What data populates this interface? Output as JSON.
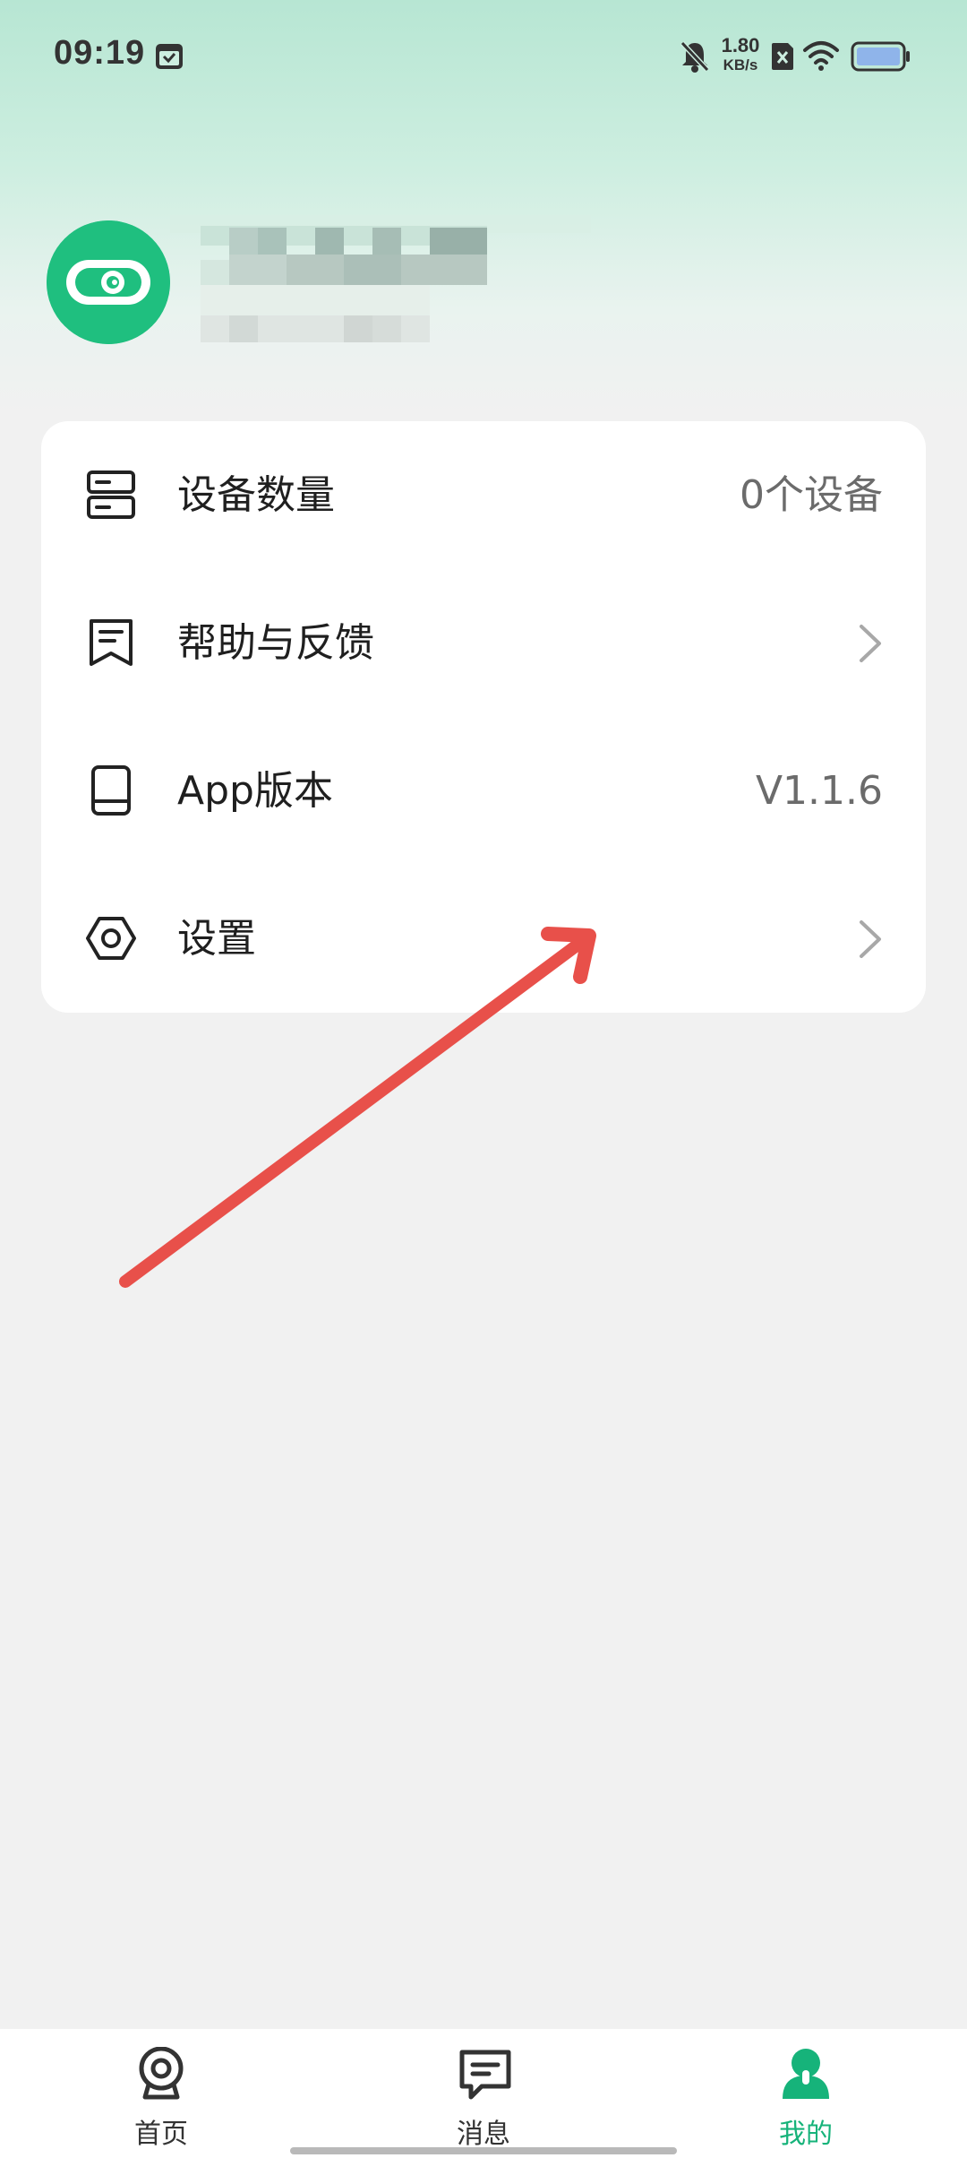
{
  "status_bar": {
    "time": "09:19",
    "net_speed_value": "1.80",
    "net_speed_unit": "KB/s",
    "icons": [
      "calendar-icon",
      "mute-bell-icon",
      "no-sim-icon",
      "wifi-icon",
      "battery-icon"
    ]
  },
  "colors": {
    "accent": "#16b37a",
    "avatar_bg": "#1fbf7f",
    "annotation_arrow": "#e8504a"
  },
  "menu": {
    "items": [
      {
        "label": "设备数量",
        "value": "0个设备",
        "icon": "device-list-icon"
      },
      {
        "label": "帮助与反馈",
        "icon": "feedback-icon",
        "trailing": "chevron-right-icon"
      },
      {
        "label": "App版本",
        "value": "V1.1.6",
        "icon": "tablet-icon"
      },
      {
        "label": "设置",
        "icon": "settings-hex-icon",
        "trailing": "chevron-right-icon"
      }
    ]
  },
  "bottom_nav": {
    "items": [
      {
        "label": "首页",
        "icon": "camera-home-icon"
      },
      {
        "label": "消息",
        "icon": "message-icon"
      },
      {
        "label": "我的",
        "icon": "user-icon",
        "active": true
      }
    ]
  }
}
